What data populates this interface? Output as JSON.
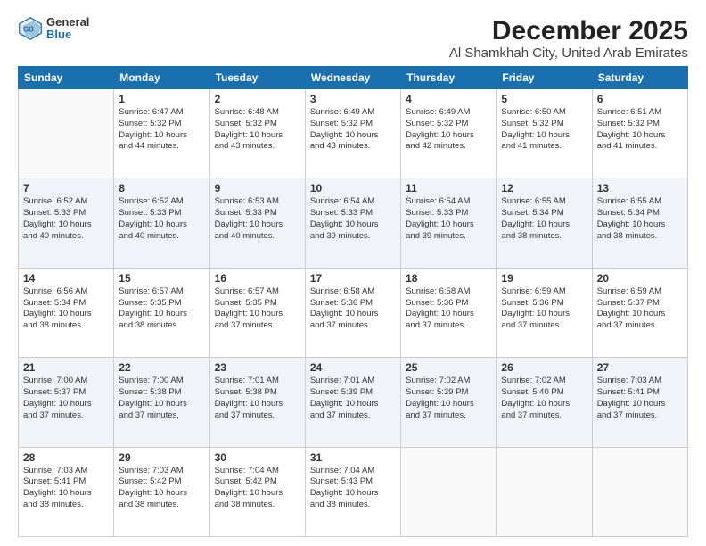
{
  "header": {
    "logo_general": "General",
    "logo_blue": "Blue",
    "title": "December 2025",
    "subtitle": "Al Shamkhah City, United Arab Emirates"
  },
  "calendar": {
    "days_of_week": [
      "Sunday",
      "Monday",
      "Tuesday",
      "Wednesday",
      "Thursday",
      "Friday",
      "Saturday"
    ],
    "weeks": [
      [
        {
          "day": "",
          "info": ""
        },
        {
          "day": "1",
          "info": "Sunrise: 6:47 AM\nSunset: 5:32 PM\nDaylight: 10 hours\nand 44 minutes."
        },
        {
          "day": "2",
          "info": "Sunrise: 6:48 AM\nSunset: 5:32 PM\nDaylight: 10 hours\nand 43 minutes."
        },
        {
          "day": "3",
          "info": "Sunrise: 6:49 AM\nSunset: 5:32 PM\nDaylight: 10 hours\nand 43 minutes."
        },
        {
          "day": "4",
          "info": "Sunrise: 6:49 AM\nSunset: 5:32 PM\nDaylight: 10 hours\nand 42 minutes."
        },
        {
          "day": "5",
          "info": "Sunrise: 6:50 AM\nSunset: 5:32 PM\nDaylight: 10 hours\nand 41 minutes."
        },
        {
          "day": "6",
          "info": "Sunrise: 6:51 AM\nSunset: 5:32 PM\nDaylight: 10 hours\nand 41 minutes."
        }
      ],
      [
        {
          "day": "7",
          "info": "Sunrise: 6:52 AM\nSunset: 5:33 PM\nDaylight: 10 hours\nand 40 minutes."
        },
        {
          "day": "8",
          "info": "Sunrise: 6:52 AM\nSunset: 5:33 PM\nDaylight: 10 hours\nand 40 minutes."
        },
        {
          "day": "9",
          "info": "Sunrise: 6:53 AM\nSunset: 5:33 PM\nDaylight: 10 hours\nand 40 minutes."
        },
        {
          "day": "10",
          "info": "Sunrise: 6:54 AM\nSunset: 5:33 PM\nDaylight: 10 hours\nand 39 minutes."
        },
        {
          "day": "11",
          "info": "Sunrise: 6:54 AM\nSunset: 5:33 PM\nDaylight: 10 hours\nand 39 minutes."
        },
        {
          "day": "12",
          "info": "Sunrise: 6:55 AM\nSunset: 5:34 PM\nDaylight: 10 hours\nand 38 minutes."
        },
        {
          "day": "13",
          "info": "Sunrise: 6:55 AM\nSunset: 5:34 PM\nDaylight: 10 hours\nand 38 minutes."
        }
      ],
      [
        {
          "day": "14",
          "info": "Sunrise: 6:56 AM\nSunset: 5:34 PM\nDaylight: 10 hours\nand 38 minutes."
        },
        {
          "day": "15",
          "info": "Sunrise: 6:57 AM\nSunset: 5:35 PM\nDaylight: 10 hours\nand 38 minutes."
        },
        {
          "day": "16",
          "info": "Sunrise: 6:57 AM\nSunset: 5:35 PM\nDaylight: 10 hours\nand 37 minutes."
        },
        {
          "day": "17",
          "info": "Sunrise: 6:58 AM\nSunset: 5:36 PM\nDaylight: 10 hours\nand 37 minutes."
        },
        {
          "day": "18",
          "info": "Sunrise: 6:58 AM\nSunset: 5:36 PM\nDaylight: 10 hours\nand 37 minutes."
        },
        {
          "day": "19",
          "info": "Sunrise: 6:59 AM\nSunset: 5:36 PM\nDaylight: 10 hours\nand 37 minutes."
        },
        {
          "day": "20",
          "info": "Sunrise: 6:59 AM\nSunset: 5:37 PM\nDaylight: 10 hours\nand 37 minutes."
        }
      ],
      [
        {
          "day": "21",
          "info": "Sunrise: 7:00 AM\nSunset: 5:37 PM\nDaylight: 10 hours\nand 37 minutes."
        },
        {
          "day": "22",
          "info": "Sunrise: 7:00 AM\nSunset: 5:38 PM\nDaylight: 10 hours\nand 37 minutes."
        },
        {
          "day": "23",
          "info": "Sunrise: 7:01 AM\nSunset: 5:38 PM\nDaylight: 10 hours\nand 37 minutes."
        },
        {
          "day": "24",
          "info": "Sunrise: 7:01 AM\nSunset: 5:39 PM\nDaylight: 10 hours\nand 37 minutes."
        },
        {
          "day": "25",
          "info": "Sunrise: 7:02 AM\nSunset: 5:39 PM\nDaylight: 10 hours\nand 37 minutes."
        },
        {
          "day": "26",
          "info": "Sunrise: 7:02 AM\nSunset: 5:40 PM\nDaylight: 10 hours\nand 37 minutes."
        },
        {
          "day": "27",
          "info": "Sunrise: 7:03 AM\nSunset: 5:41 PM\nDaylight: 10 hours\nand 37 minutes."
        }
      ],
      [
        {
          "day": "28",
          "info": "Sunrise: 7:03 AM\nSunset: 5:41 PM\nDaylight: 10 hours\nand 38 minutes."
        },
        {
          "day": "29",
          "info": "Sunrise: 7:03 AM\nSunset: 5:42 PM\nDaylight: 10 hours\nand 38 minutes."
        },
        {
          "day": "30",
          "info": "Sunrise: 7:04 AM\nSunset: 5:42 PM\nDaylight: 10 hours\nand 38 minutes."
        },
        {
          "day": "31",
          "info": "Sunrise: 7:04 AM\nSunset: 5:43 PM\nDaylight: 10 hours\nand 38 minutes."
        },
        {
          "day": "",
          "info": ""
        },
        {
          "day": "",
          "info": ""
        },
        {
          "day": "",
          "info": ""
        }
      ]
    ]
  }
}
